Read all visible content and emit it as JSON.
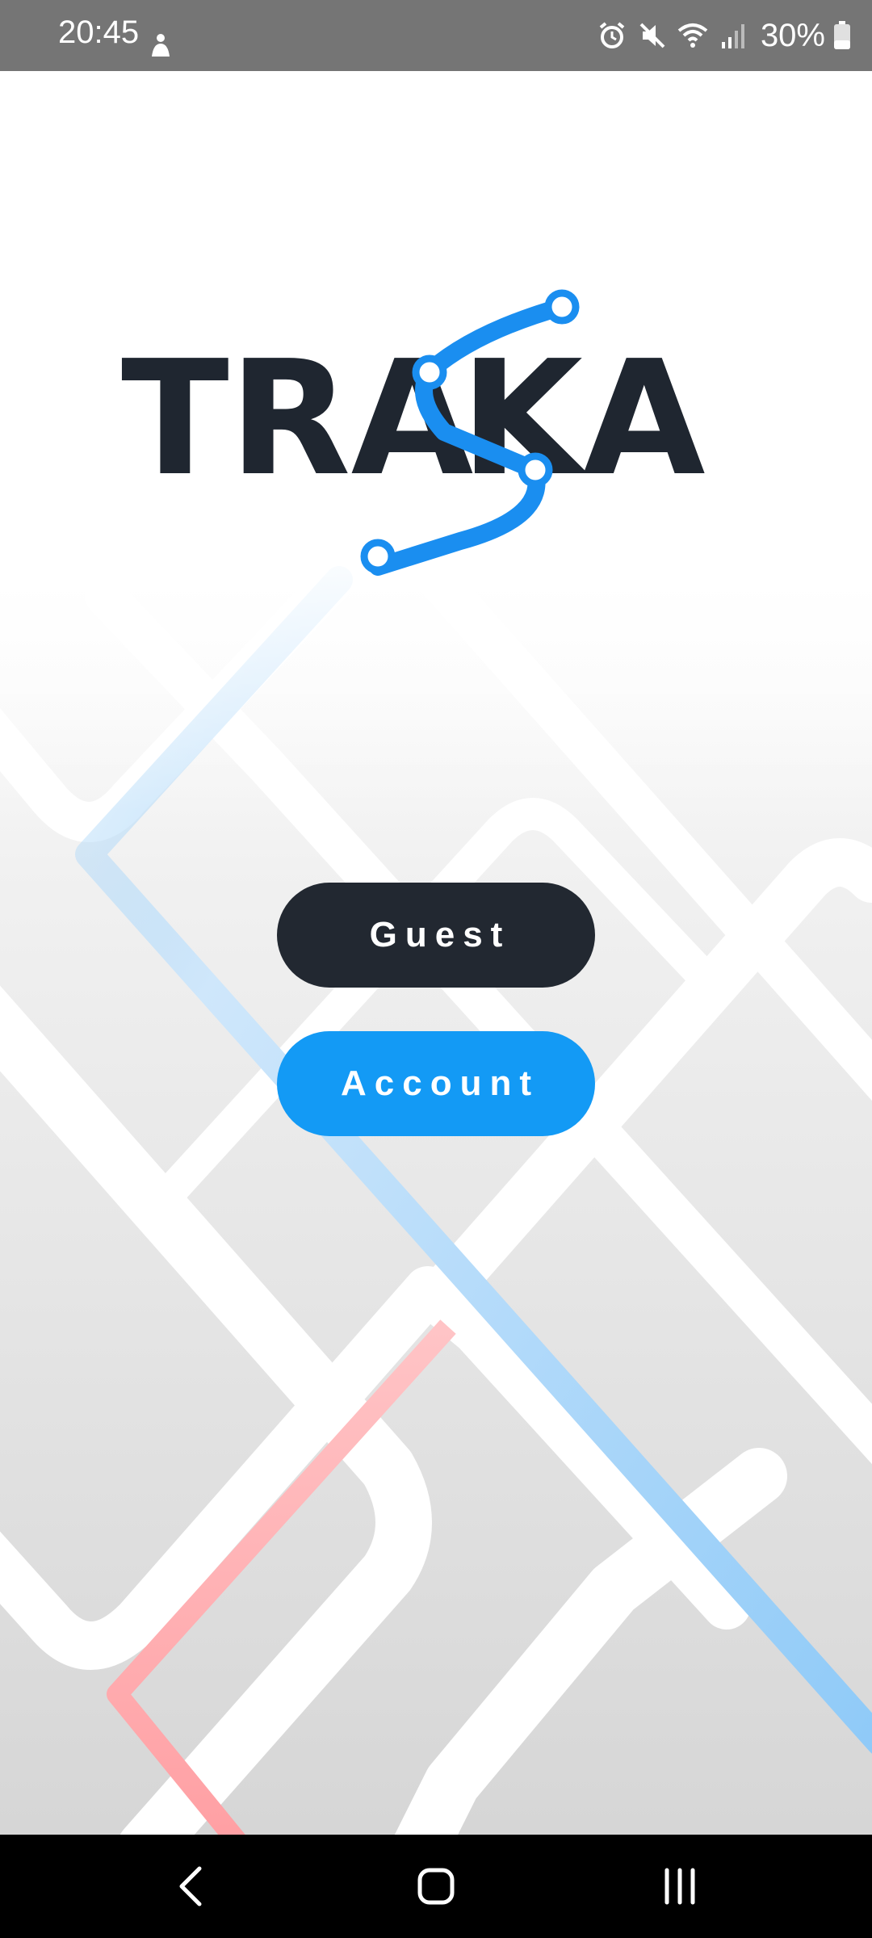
{
  "status_bar": {
    "time": "20:45",
    "battery_percent": "30%",
    "icons": [
      "person-icon",
      "alarm-icon",
      "mute-icon",
      "wifi-icon",
      "signal-icon",
      "battery-icon"
    ]
  },
  "logo": {
    "text": "TRASKA",
    "brand_dark": "#1f2630",
    "brand_blue": "#1a8ef0"
  },
  "actions": {
    "guest_label": "Guest",
    "account_label": "Account"
  },
  "nav_bar": {
    "icons": [
      "back-icon",
      "home-icon",
      "recent-apps-icon"
    ]
  },
  "colors": {
    "guest_button": "#222831",
    "account_button": "#139af5",
    "route_blue": "#8fcaf8",
    "route_red": "#ff9fa3"
  }
}
